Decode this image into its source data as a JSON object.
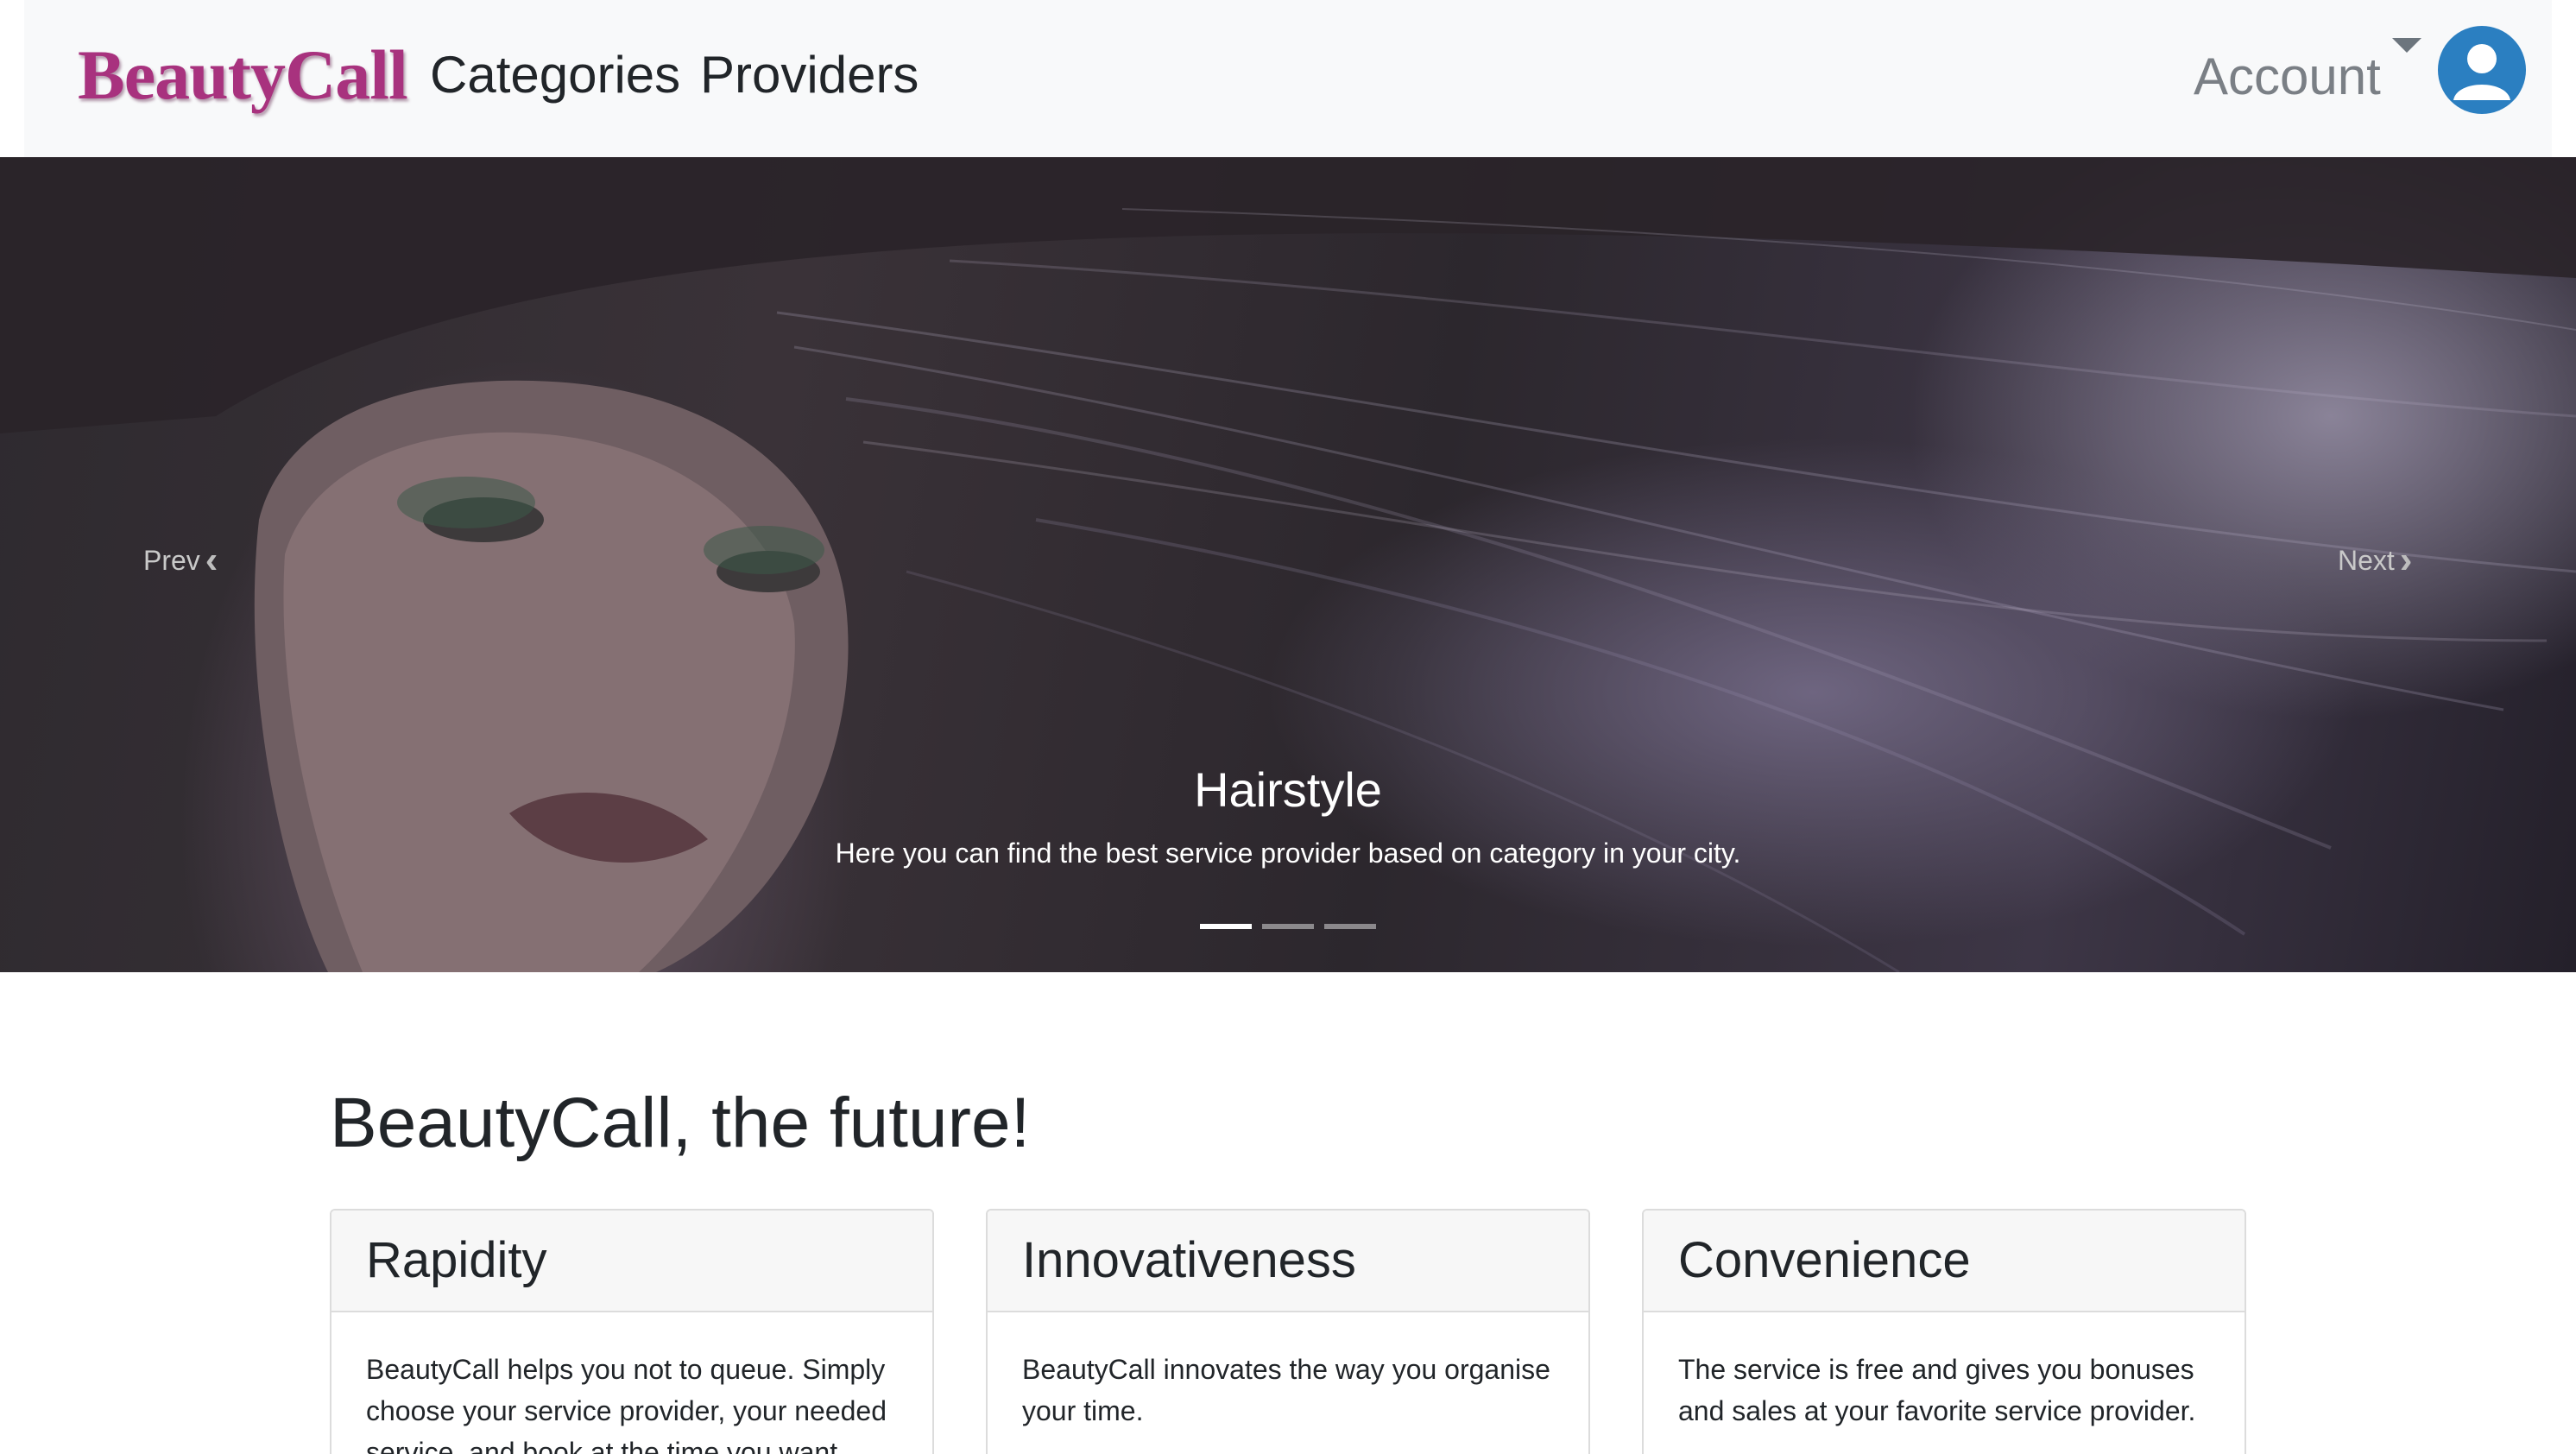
{
  "navbar": {
    "brand": "BeautyCall",
    "links": [
      "Categories",
      "Providers"
    ],
    "account_label": "Account",
    "colors": {
      "brand": "#a8327e",
      "avatar": "#2b7fc1",
      "background": "#f8f9fa"
    }
  },
  "carousel": {
    "prev_label": "Prev",
    "next_label": "Next",
    "slide": {
      "title": "Hairstyle",
      "text": "Here you can find the best service provider based on category in your city."
    },
    "slide_count": 3,
    "active_index": 0
  },
  "main": {
    "headline": "BeautyCall, the future!",
    "cards": [
      {
        "title": "Rapidity",
        "text": "BeautyCall helps you not to queue. Simply choose your service provider, your needed service, and book at the time you want."
      },
      {
        "title": "Innovativeness",
        "text": "BeautyCall innovates the way you organise your time."
      },
      {
        "title": "Convenience",
        "text": "The service is free and gives you bonuses and sales at your favorite service provider."
      }
    ]
  }
}
